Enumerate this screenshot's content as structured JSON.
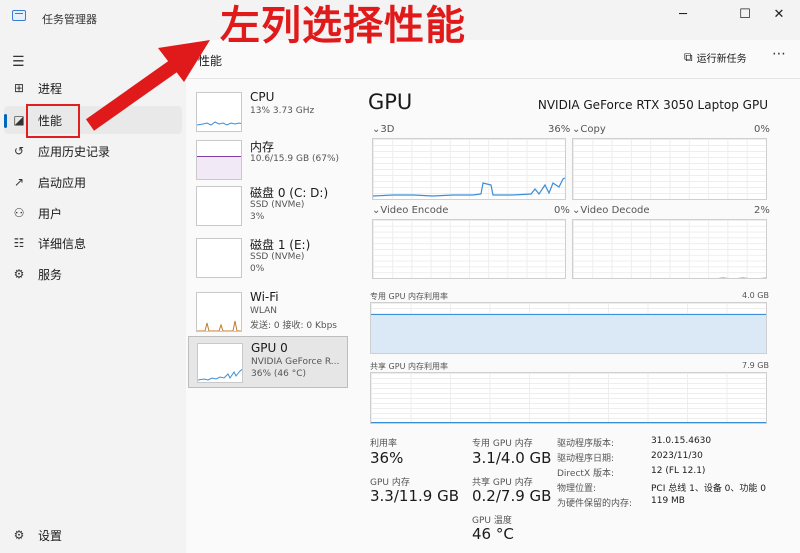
{
  "window": {
    "title": "任务管理器"
  },
  "annotation": {
    "text": "左列选择性能"
  },
  "nav": {
    "items": [
      {
        "icon": "process-icon",
        "label": "进程"
      },
      {
        "icon": "performance-icon",
        "label": "性能"
      },
      {
        "icon": "app-history-icon",
        "label": "应用历史记录"
      },
      {
        "icon": "startup-icon",
        "label": "启动应用"
      },
      {
        "icon": "users-icon",
        "label": "用户"
      },
      {
        "icon": "details-icon",
        "label": "详细信息"
      },
      {
        "icon": "services-icon",
        "label": "服务"
      }
    ],
    "settings_label": "设置",
    "active": "性能"
  },
  "header": {
    "page_title": "性能",
    "run_task_label": "运行新任务"
  },
  "devices": [
    {
      "name": "CPU",
      "line1": "13% 3.73 GHz",
      "line2": ""
    },
    {
      "name": "内存",
      "line1": "10.6/15.9 GB (67%)",
      "line2": ""
    },
    {
      "name": "磁盘 0 (C: D:)",
      "line1": "SSD (NVMe)",
      "line2": "3%"
    },
    {
      "name": "磁盘 1 (E:)",
      "line1": "SSD (NVMe)",
      "line2": "0%"
    },
    {
      "name": "Wi-Fi",
      "line1": "WLAN",
      "line2": "发送: 0 接收: 0 Kbps"
    },
    {
      "name": "GPU 0",
      "line1": "NVIDIA GeForce R...",
      "line2": "36% (46 °C)"
    }
  ],
  "gpu": {
    "title": "GPU",
    "model": "NVIDIA GeForce RTX 3050 Laptop GPU",
    "engines": [
      {
        "name": "3D",
        "pct": "36%"
      },
      {
        "name": "Copy",
        "pct": "0%"
      },
      {
        "name": "Video Encode",
        "pct": "0%"
      },
      {
        "name": "Video Decode",
        "pct": "2%"
      }
    ],
    "dedicated_label": "专用 GPU 内存利用率",
    "dedicated_max": "4.0 GB",
    "shared_label": "共享 GPU 内存利用率",
    "shared_max": "7.9 GB",
    "stats": {
      "util_label": "利用率",
      "util_value": "36%",
      "gpu_mem_label": "GPU 内存",
      "gpu_mem_value": "3.3/11.9 GB",
      "dedicated_mem_label": "专用 GPU 内存",
      "dedicated_mem_value": "3.1/4.0 GB",
      "shared_mem_label": "共享 GPU 内存",
      "shared_mem_value": "0.2/7.9 GB",
      "temp_label": "GPU 温度",
      "temp_value": "46 °C"
    },
    "info": [
      {
        "key": "驱动程序版本:",
        "value": "31.0.15.4630"
      },
      {
        "key": "驱动程序日期:",
        "value": "2023/11/30"
      },
      {
        "key": "DirectX 版本:",
        "value": "12 (FL 12.1)"
      },
      {
        "key": "物理位置:",
        "value": "PCI 总线 1、设备 0、功能 0"
      },
      {
        "key": "为硬件保留的内存:",
        "value": "119 MB"
      }
    ]
  },
  "colors": {
    "accent": "#0067c0",
    "graph_line": "#3b8ed8",
    "memory_line": "#7b3fa6",
    "disk_line": "#6aa84f",
    "wifi_line": "#c57a2b",
    "annotation": "#e01a1a"
  }
}
